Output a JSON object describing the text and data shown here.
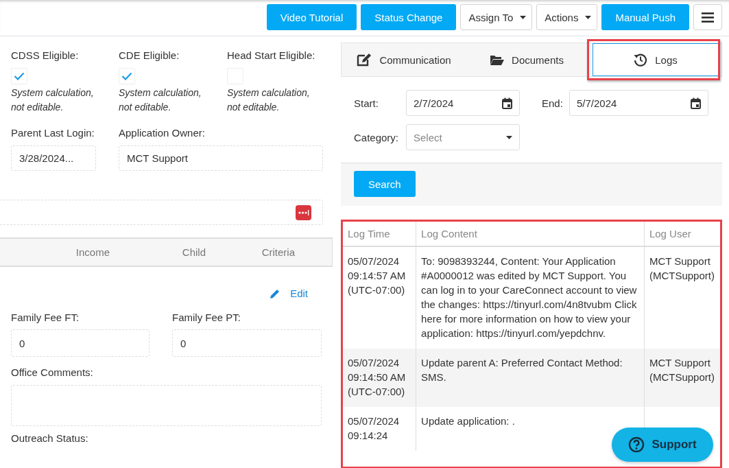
{
  "toolbar": {
    "buttons": [
      {
        "label": "Video Tutorial",
        "kind": "primary"
      },
      {
        "label": "Status Change",
        "kind": "primary"
      },
      {
        "label": "Assign To",
        "kind": "dropdown"
      },
      {
        "label": "Actions",
        "kind": "dropdown"
      },
      {
        "label": "Manual Push",
        "kind": "primary"
      },
      {
        "kind": "menu"
      }
    ]
  },
  "eligibility": [
    {
      "label": "CDSS Eligible:",
      "checked": true,
      "note": "System calculation, not editable."
    },
    {
      "label": "CDE Eligible:",
      "checked": true,
      "note": "System calculation, not editable."
    },
    {
      "label": "Head Start Eligible:",
      "checked": false,
      "note": "System calculation, not editable."
    }
  ],
  "info_fields": [
    {
      "label": "Parent Last Login:",
      "value": "3/28/2024..."
    },
    {
      "label": "Application Owner:",
      "value": "MCT Support"
    }
  ],
  "section_tabs": [
    {
      "label": "Income"
    },
    {
      "label": "Child"
    },
    {
      "label": "Criteria"
    }
  ],
  "edit_link": "Edit",
  "fees": [
    {
      "label": "Family Fee FT:",
      "value": "0"
    },
    {
      "label": "Family Fee PT:",
      "value": "0"
    }
  ],
  "office_comments": {
    "label": "Office Comments:"
  },
  "outreach_status": {
    "label": "Outreach Status:"
  },
  "panel_tabs": [
    {
      "label": "Communication",
      "selected": false
    },
    {
      "label": "Documents",
      "selected": false
    },
    {
      "label": "Logs",
      "selected": true
    }
  ],
  "log_filter": {
    "start": {
      "label": "Start:",
      "value": "2/7/2024"
    },
    "end": {
      "label": "End:",
      "value": "5/7/2024"
    },
    "category": {
      "label": "Category:",
      "placeholder": "Select"
    },
    "search_button": "Search"
  },
  "log_table": {
    "columns": [
      "Log Time",
      "Log Content",
      "Log User"
    ],
    "rows": [
      {
        "time": "05/07/2024 09:14:57 AM (UTC-07:00)",
        "content": "To: 9098393244, Content: Your Application #A0000012 was edited by MCT Support. You can log in to your CareConnect account to view the changes: https://tinyurl.com/4n8tvubm Click here for more information on how to view your application: https://tinyurl.com/yepdchnv.",
        "user": "MCT Support (MCTSupport)"
      },
      {
        "time": "05/07/2024 09:14:50 AM (UTC-07:00)",
        "content": "Update parent A: Preferred Contact Method: SMS.",
        "user": "MCT Support (MCTSupport)"
      },
      {
        "time": "05/07/2024 09:14:24",
        "content": "Update application: ."
      }
    ]
  },
  "support_button": "Support"
}
